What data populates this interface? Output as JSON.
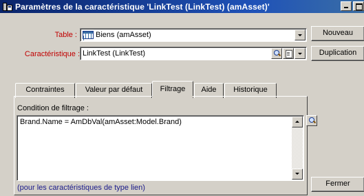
{
  "window": {
    "title": "Paramètres de la caractéristique 'LinkTest (LinkTest) (amAsset)'"
  },
  "form": {
    "table_label": "Table :",
    "table_value": "Biens (amAsset)",
    "characteristic_label": "Caractéristique :",
    "characteristic_value": "LinkTest (LinkTest)"
  },
  "buttons": {
    "new": "Nouveau",
    "duplicate": "Duplication",
    "close": "Fermer"
  },
  "tabs": [
    {
      "label": "Contraintes",
      "active": false
    },
    {
      "label": "Valeur par défaut",
      "active": false
    },
    {
      "label": "Filtrage",
      "active": true
    },
    {
      "label": "Aide",
      "active": false
    },
    {
      "label": "Historique",
      "active": false
    }
  ],
  "filter": {
    "label": "Condition de filtrage :",
    "value": "Brand.Name = AmDbVal(amAsset:Model.Brand)",
    "hint": "(pour les caractéristiques de type lien)"
  },
  "colors": {
    "title_bar": "#0a246a",
    "required_label": "#c00000",
    "hint_text": "#1a1a8a",
    "dialog_bg": "#d4d0c8"
  },
  "icons": {
    "table_icon": "table-icon",
    "search_icon": "magnifier-icon",
    "detail_icon": "detail-icon",
    "dropdown_icon": "chevron-down-icon"
  }
}
